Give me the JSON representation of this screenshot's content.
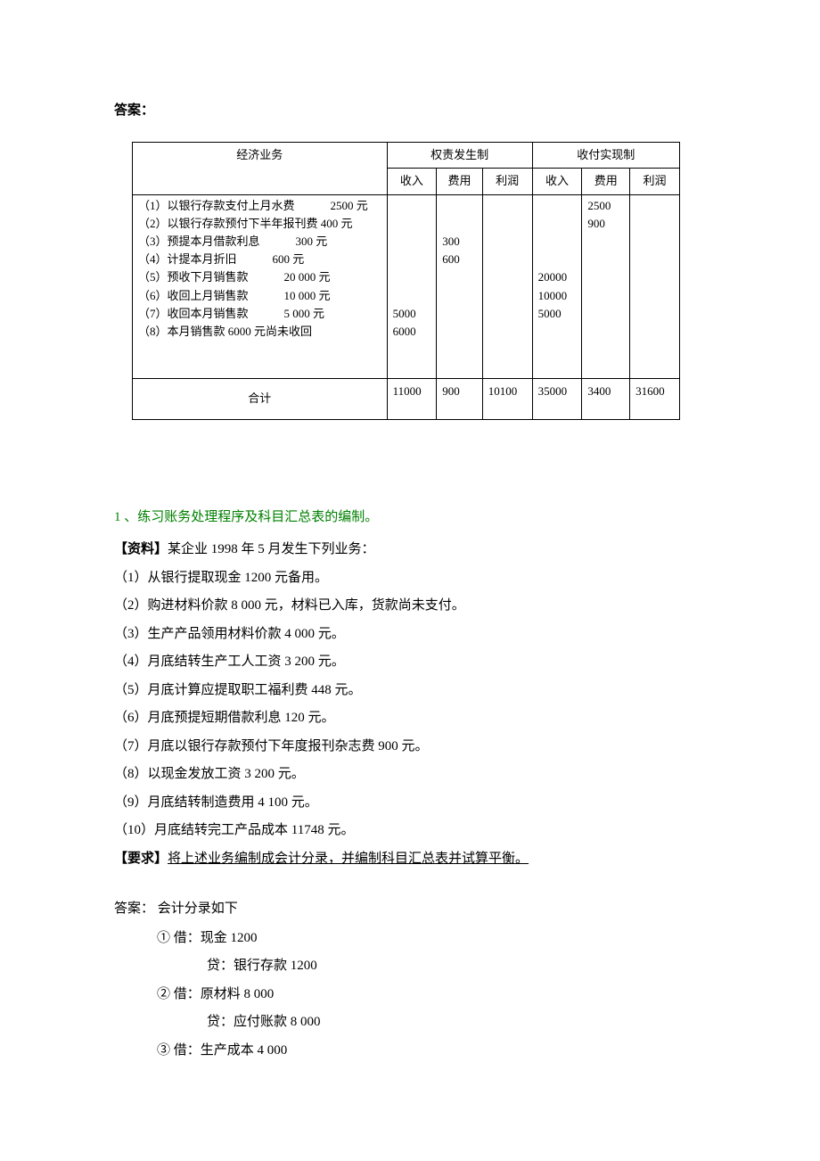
{
  "answer_label": "答案：",
  "table": {
    "col_business": "经济业务",
    "group_accrual": "权责发生制",
    "group_cash": "收付实现制",
    "col_income": "收入",
    "col_expense": "费用",
    "col_profit": "利润",
    "rows": [
      {
        "desc": "（1）以银行存款支付上月水费",
        "amt": "2500 元",
        "a_income": "",
        "a_expense": "",
        "a_profit": "",
        "c_income": "",
        "c_expense": "2500",
        "c_profit": ""
      },
      {
        "desc": "（2）以银行存款预付下半年报刊费 400 元",
        "amt": "",
        "a_income": "",
        "a_expense": "",
        "a_profit": "",
        "c_income": "",
        "c_expense": "900",
        "c_profit": ""
      },
      {
        "desc": "（3）预提本月借款利息",
        "amt": "300 元",
        "a_income": "",
        "a_expense": "300",
        "a_profit": "",
        "c_income": "",
        "c_expense": "",
        "c_profit": ""
      },
      {
        "desc": "（4）计提本月折旧",
        "amt": "600 元",
        "a_income": "",
        "a_expense": "600",
        "a_profit": "",
        "c_income": "",
        "c_expense": "",
        "c_profit": ""
      },
      {
        "desc": "（5）预收下月销售款",
        "amt": "20 000 元",
        "a_income": "",
        "a_expense": "",
        "a_profit": "",
        "c_income": "20000",
        "c_expense": "",
        "c_profit": ""
      },
      {
        "desc": "（6）收回上月销售款",
        "amt": "10 000 元",
        "a_income": "",
        "a_expense": "",
        "a_profit": "",
        "c_income": "10000",
        "c_expense": "",
        "c_profit": ""
      },
      {
        "desc": "（7）收回本月销售款",
        "amt": "5 000 元",
        "a_income": "5000",
        "a_expense": "",
        "a_profit": "",
        "c_income": "5000",
        "c_expense": "",
        "c_profit": ""
      },
      {
        "desc": "（8）本月销售款 6000 元尚未收回",
        "amt": "",
        "a_income": "6000",
        "a_expense": "",
        "a_profit": "",
        "c_income": "",
        "c_expense": "",
        "c_profit": ""
      }
    ],
    "total_label": "合计",
    "total": {
      "a_income": "11000",
      "a_expense": "900",
      "a_profit": "10100",
      "c_income": "35000",
      "c_expense": "3400",
      "c_profit": "31600"
    }
  },
  "exercise": {
    "title_num": "1 、",
    "title_text": "练习账务处理程序及科目汇总表的编制。",
    "material_label": "【资料】",
    "material_text": "某企业 1998 年 5 月发生下列业务：",
    "items": [
      "（1）从银行提取现金 1200 元备用。",
      "（2）购进材料价款 8 000 元，材料已入库，货款尚未支付。",
      "（3）生产产品领用材料价款 4 000 元。",
      "（4）月底结转生产工人工资 3 200 元。",
      "（5）月底计算应提取职工福利费 448 元。",
      "（6）月底预提短期借款利息 120 元。",
      "（7）月底以银行存款预付下年度报刊杂志费 900 元。",
      "（8）以现金发放工资 3 200 元。",
      "（9）月底结转制造费用 4 100 元。",
      "（10）月底结转完工产品成本 11748 元。"
    ],
    "req_label": "【要求】",
    "req_text": "将上述业务编制成会计分录，并编制科目汇总表并试算平衡。"
  },
  "answer2": {
    "label": "答案： 会计分录如下",
    "entries": [
      {
        "debit": "① 借：现金 1200",
        "credit": "贷：银行存款 1200"
      },
      {
        "debit": "② 借：原材料 8 000",
        "credit": "贷：应付账款 8 000"
      },
      {
        "debit": "③ 借：生产成本 4 000",
        "credit": ""
      }
    ]
  }
}
